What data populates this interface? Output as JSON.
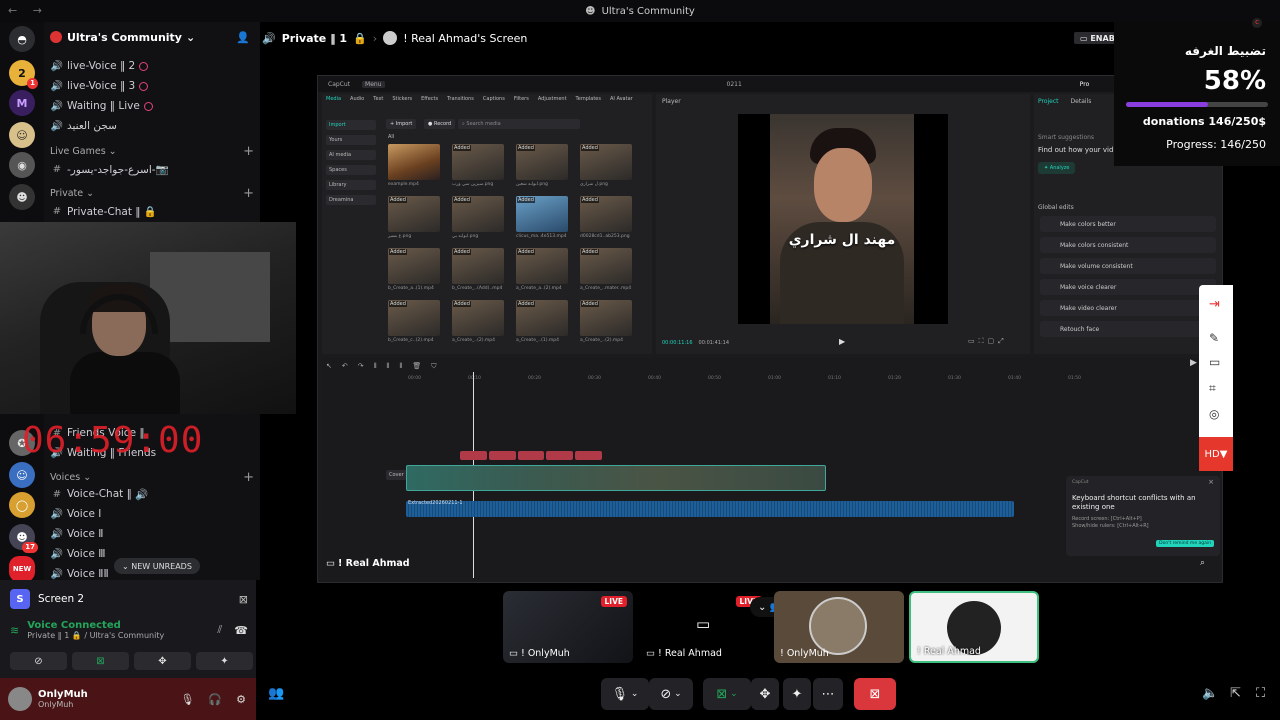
{
  "window": {
    "title": "Ultra's Community",
    "nav_back": "←",
    "nav_fwd": "→"
  },
  "rail": {
    "servers": [
      {
        "glyph": "D",
        "color": "#5865f2",
        "name": "discord-home"
      },
      {
        "glyph": "2",
        "color": "#e8b23a",
        "badge": "1"
      },
      {
        "glyph": "M",
        "color": "#6a3fa0"
      },
      {
        "glyph": "☺",
        "color": "#d8c08a"
      },
      {
        "glyph": "◉",
        "color": "#444"
      },
      {
        "glyph": "?",
        "color": "#777"
      }
    ],
    "lower": [
      {
        "glyph": "✪",
        "color": "#555"
      },
      {
        "glyph": "☻",
        "color": "#777"
      },
      {
        "glyph": "☺",
        "color": "#3a6ec0"
      },
      {
        "glyph": "◯",
        "color": "#d8a030"
      },
      {
        "glyph": "☻",
        "color": "#556",
        "badge": "17"
      },
      {
        "glyph": "NEW",
        "color": "#e0202a"
      }
    ]
  },
  "sidebar": {
    "server_name": "Ultra's Community",
    "channels_top": [
      {
        "icon": "🔊",
        "label": "live-Voice ‖ 2"
      },
      {
        "icon": "🔊",
        "label": "live-Voice ‖ 3"
      },
      {
        "icon": "🔊",
        "label": "Waiting ‖ Live"
      },
      {
        "icon": "🔊",
        "label": "سجن العنيد"
      }
    ],
    "cat_live_games": "Live Games",
    "live_games_channel": "-اسرع-جواجد-يسور-📷",
    "cat_private": "Private",
    "private_channel": "Private-Chat ‖ 🔒",
    "friends_channel": "Friends Voice ‖",
    "waiting_friends": "Waiting ‖ Friends",
    "cat_voices": "Voices",
    "voice_channels": [
      "Voice-Chat ‖",
      "Voice Ⅰ",
      "Voice Ⅱ",
      "Voice Ⅲ",
      "Voice ⅡⅡ"
    ],
    "new_unreads": "NEW UNREADS"
  },
  "timer": "06:59:00",
  "screen_panel": {
    "screen_label": "Screen 2",
    "voice_connected": "Voice Connected",
    "voice_sub": "Private ‖ 1 🔒 / Ultra's Community",
    "user_name": "OnlyMuh",
    "user_sub": "OnlyMuh"
  },
  "stage": {
    "channel": "Private ‖ 1",
    "screen_title": "! Real Ahmad's Screen",
    "enab": "ENAB",
    "presenter": "! Real Ahmad"
  },
  "capcut": {
    "top_left": "CapCut",
    "menu": "Menu",
    "project_title": "0211",
    "pro": "Pro",
    "toolbar": [
      "Media",
      "Audio",
      "Text",
      "Stickers",
      "Effects",
      "Transitions",
      "Captions",
      "Filters",
      "Adjustment",
      "Templates",
      "AI Avatar"
    ],
    "side": [
      "Import",
      "Yours",
      "AI media",
      "Spaces",
      "Library",
      "Dreamina"
    ],
    "import_btn": "Import",
    "record_btn": "Record",
    "search": "Search media",
    "all": "All",
    "thumbs": [
      {
        "label": "example.mp4",
        "added": ""
      },
      {
        "label": "سيرين سي ورب.png",
        "added": "Added"
      },
      {
        "label": "ابوابه شعين.png",
        "added": "Added"
      },
      {
        "label": "ل شراري.png",
        "added": "Added"
      },
      {
        "label": "غ بسير.png",
        "added": "Added"
      },
      {
        "label": "ابوابه بي.png",
        "added": "Added"
      },
      {
        "label": "clicus_ma..4e513.mp4",
        "added": "Added"
      },
      {
        "label": "d0028cd1..ab253.png",
        "added": "Added"
      },
      {
        "label": "b_Create_a..(1).mp4",
        "added": "Added"
      },
      {
        "label": "b_Create_..(Add)..mp4",
        "added": "Added"
      },
      {
        "label": "a_Create_a..(2).mp4",
        "added": "Added"
      },
      {
        "label": "a_Create_..mater..mp4",
        "added": "Added"
      },
      {
        "label": "b_Create_c..(2).mp4",
        "added": "Added"
      },
      {
        "label": "a_Create_..(2).mp4",
        "added": "Added"
      },
      {
        "label": "a_Create_..(1).mp4",
        "added": "Added"
      },
      {
        "label": "a_Create_..(2).mp4",
        "added": "Added"
      }
    ],
    "player_label": "Player",
    "caption": "مهند ال شراري",
    "time_current": "00:00:11:16",
    "time_total": "00:01:41:14",
    "props_tabs": [
      "Project",
      "Details"
    ],
    "smart": "Smart suggestions",
    "smart_sub": "Find out how your vid",
    "analyze": "Analyze",
    "global_edits": "Global edits",
    "edits": [
      "Make colors better",
      "Make colors consistent",
      "Make volume consistent",
      "Make voice clearer",
      "Make video clearer",
      "Retouch face"
    ],
    "ruler": [
      "00:00",
      "00:10",
      "00:20",
      "00:30",
      "00:40",
      "00:50",
      "01:00",
      "01:10",
      "01:20",
      "01:30",
      "01:40",
      "01:50"
    ],
    "cover": "Cover",
    "audio_name": "Extracted20260211-1",
    "popup_brand": "CapCut",
    "popup_title": "Keyboard shortcut conflicts with an existing one",
    "popup_line1": "Record screen: [Ctrl+Alt+P]",
    "popup_line2": "Show/hide rulers: [Ctrl+Alt+R]",
    "popup_btn": "Don't remind me again"
  },
  "donation": {
    "title": "تضبيط الغرفه",
    "percent": "58%",
    "progress": 0.58,
    "donations": "donations 146/250$",
    "progress_text": "Progress: 146/250"
  },
  "tiles": [
    {
      "name": "! OnlyMuh",
      "live": "LIVE"
    },
    {
      "name": "! Real Ahmad",
      "live": "LIVE"
    },
    {
      "name": "! OnlyMuh",
      "live": ""
    },
    {
      "name": "! Real Ahmad",
      "live": ""
    }
  ],
  "hd": "HD▼",
  "colors": {
    "accent": "#5865f2",
    "danger": "#da373c",
    "green": "#23a55a",
    "capcut_teal": "#22d3bb"
  }
}
